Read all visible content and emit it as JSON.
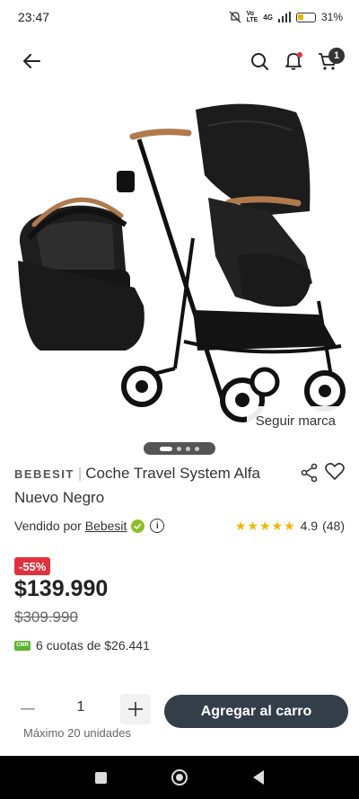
{
  "status": {
    "time": "23:47",
    "network_top": "Vo",
    "network_bottom": "LTE",
    "signal": "4G",
    "battery": "31%"
  },
  "header": {
    "back_icon": "arrow-left-icon",
    "cart_count": "1"
  },
  "gallery": {
    "follow_label": "Seguir marca",
    "slide_count": 4,
    "active_slide": 1
  },
  "product": {
    "brand": "BEBESIT",
    "name": "Coche Travel System Alfa Nuevo Negro",
    "sold_by_label": "Vendido por",
    "seller": "Bebesit",
    "rating": "4.9",
    "reviews": "(48)",
    "discount": "-55%",
    "price": "$139.990",
    "old_price": "$309.990",
    "cmr_label": "CMR",
    "installments": "6 cuotas de $26.441"
  },
  "purchase": {
    "quantity": "1",
    "max_label": "Máximo 20 unidades",
    "add_to_cart": "Agregar al carro"
  },
  "colors": {
    "accent_dark": "#343e48",
    "discount_red": "#e0323c",
    "star_yellow": "#f5b400",
    "verified_green": "#8cbf26"
  }
}
